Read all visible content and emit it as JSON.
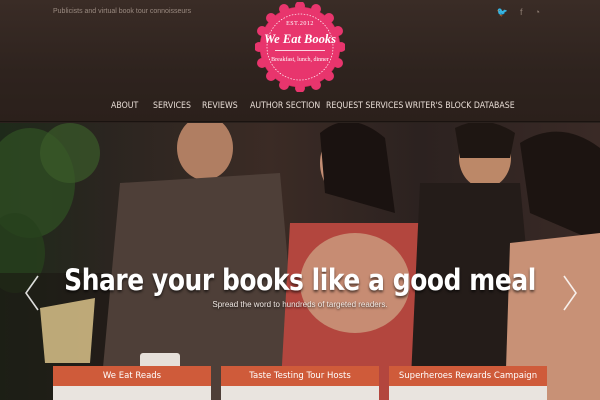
{
  "header": {
    "tagline": "Publicists and virtual book tour connoisseurs",
    "social": [
      {
        "icon": "twitter-icon",
        "glyph": "🐦"
      },
      {
        "icon": "facebook-icon",
        "glyph": "f"
      },
      {
        "icon": "rss-icon",
        "glyph": "◔"
      }
    ],
    "logo": {
      "est": "EST.2012",
      "name": "We Eat Books",
      "subtitle": "Breakfast, lunch, dinner",
      "color": "#e8356d"
    }
  },
  "nav": {
    "items": [
      {
        "label": "ABOUT"
      },
      {
        "label": "SERVICES"
      },
      {
        "label": "REVIEWS"
      },
      {
        "label": "AUTHOR SECTION"
      },
      {
        "label": "REQUEST SERVICES"
      },
      {
        "label": "WRITER'S BLOCK DATABASE"
      }
    ]
  },
  "hero": {
    "title": "Share your books like a good meal",
    "subtitle": "Spread the word to hundreds of targeted readers."
  },
  "features": [
    {
      "label": "We Eat Reads"
    },
    {
      "label": "Taste Testing Tour Hosts"
    },
    {
      "label": "Superheroes Rewards Campaign"
    }
  ],
  "colors": {
    "accent": "#cf5b3a",
    "logo_pink": "#e8356d",
    "header_bg": "#34271f"
  }
}
